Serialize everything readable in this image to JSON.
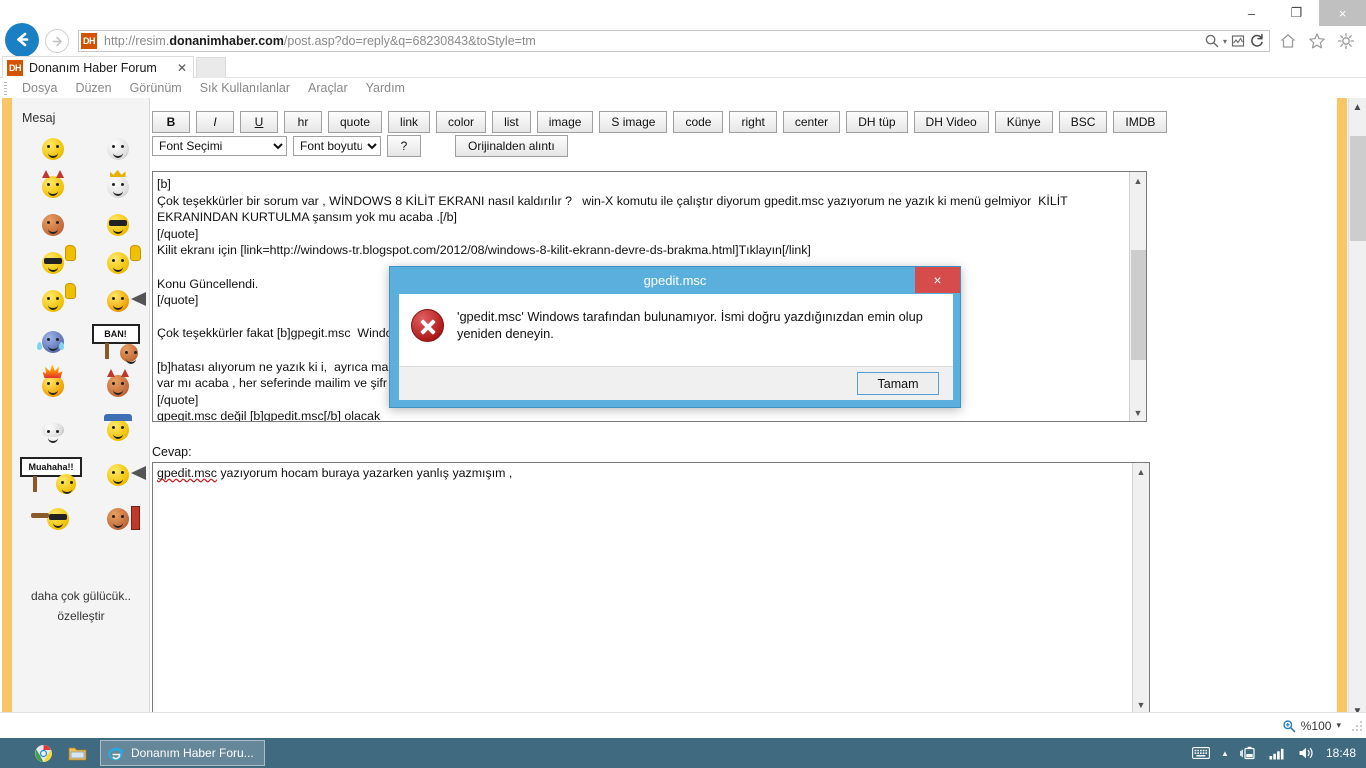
{
  "window": {
    "minimize": "–",
    "maximize": "❐",
    "close": "×"
  },
  "browser": {
    "favicon_text": "DH",
    "url_scheme": "http://",
    "url_domain_prefix": "resim.",
    "url_domain_bold": "donanimhaber.com",
    "url_path": "/post.asp?do=reply&q=68230843&toStyle=tm",
    "back_icon": "back-arrow-icon",
    "forward_icon": "forward-arrow-icon",
    "search_icon": "🔍",
    "dropdown_caret": "▾",
    "compat_icon": "compatibility-view-icon",
    "refresh_icon": "↻",
    "home_icon": "⌂",
    "favorites_icon": "☆",
    "settings_icon": "⚙"
  },
  "tab": {
    "title": "Donanım Haber Forum",
    "close": "✕"
  },
  "menubar": {
    "items": [
      "Dosya",
      "Düzen",
      "Görünüm",
      "Sık Kullanılanlar",
      "Araçlar",
      "Yardım"
    ]
  },
  "sidebar": {
    "title": "Mesaj",
    "footer_line1": "daha çok gülücük..",
    "footer_line2": "özelleştir",
    "sign_ban": "BAN!",
    "sign_muahaha": "Muahaha!!",
    "emoticons": [
      "smiley-yellow",
      "smiley-globe",
      "smiley-devil",
      "smiley-king-globe",
      "smiley-brown",
      "smiley-sunglasses",
      "smiley-cool-thumb",
      "smiley-thumbs-up",
      "smiley-pointing",
      "smiley-megaphone",
      "smiley-crying-blue",
      "smiley-ban-sign",
      "smiley-flame-head",
      "smiley-devil-brown",
      "smiley-ufo",
      "smiley-police-hat",
      "smiley-muahaha-sign",
      "smiley-loudspeaker",
      "smiley-broom-viking",
      "smiley-book"
    ]
  },
  "toolbar": {
    "row1": [
      {
        "label": "B",
        "name": "bold-button"
      },
      {
        "label": "I",
        "name": "italic-button"
      },
      {
        "label": "U",
        "name": "underline-button"
      },
      {
        "label": "hr",
        "name": "hr-button"
      },
      {
        "label": "quote",
        "name": "quote-button"
      },
      {
        "label": "link",
        "name": "link-button"
      },
      {
        "label": "color",
        "name": "color-button"
      },
      {
        "label": "list",
        "name": "list-button"
      },
      {
        "label": "image",
        "name": "image-button"
      },
      {
        "label": "S image",
        "name": "s-image-button"
      },
      {
        "label": "code",
        "name": "code-button"
      },
      {
        "label": "right",
        "name": "right-align-button"
      },
      {
        "label": "center",
        "name": "center-align-button"
      },
      {
        "label": "DH tüp",
        "name": "dh-tup-button"
      },
      {
        "label": "DH Video",
        "name": "dh-video-button"
      },
      {
        "label": "Künye",
        "name": "kunye-button"
      },
      {
        "label": "BSC",
        "name": "bsc-button"
      },
      {
        "label": "IMDB",
        "name": "imdb-button"
      }
    ],
    "font_select": "Font Seçimi",
    "size_select": "Font boyutu",
    "help_label": "?",
    "original_quote_label": "Orijinalden alıntı"
  },
  "quote_editor": {
    "name": "quote-textarea",
    "content": "[b]\nÇok teşekkürler bir sorum var , WİNDOWS 8 KİLİT EKRANI nasıl kaldırılır ?   win-X komutu ile çalıştır diyorum gpedit.msc yazıyorum ne yazık ki menü gelmiyor  KİLİT EKRANINDAN KURTULMA şansım yok mu acaba .[/b]\n[/quote]\nKilit ekranı için [link=http://windows-tr.blogspot.com/2012/08/windows-8-kilit-ekrann-devre-ds-brakma.html]Tıklayın[/link]\n\nKonu Güncellendi.\n[/quote]\n\nÇok teşekkürler fakat [b]gpegit.msc  Windows tarafından bulunamıyor.[/b]\n\n[b]hatası alıyorum ne yazık ki i,  ayrıca ma                                                                                   ifre soruyor başka bir yolu\nvar mı acaba , her seferinde mailim ve şifr\n[/quote]\ngpegit.msc değil [b]gpedit.msc[/b] olacak\n[/quote]"
  },
  "reply": {
    "label": "Cevap:",
    "misspelled_word": "gpedit.msc",
    "rest_text": " yazıyorum hocam buraya yazarken yanlış yazmışım ,"
  },
  "dialog": {
    "title": "gpedit.msc",
    "close": "×",
    "icon": "error-icon",
    "message": "'gpedit.msc' Windows tarafından bulunamıyor. İsmi doğru yazdığınızdan emin olup yeniden deneyin.",
    "ok_label": "Tamam"
  },
  "statusbar": {
    "zoom_icon": "🔍",
    "zoom_level": "%100",
    "caret": "▾"
  },
  "taskbar": {
    "chrome_icon": "chrome-icon",
    "explorer_icon": "file-explorer-icon",
    "task_label": "Donanım Haber Foru...",
    "task_icon": "internet-explorer-icon",
    "tray": {
      "keyboard_icon": "keyboard-icon",
      "show_hidden_icon": "▲",
      "battery_icon": "battery-icon",
      "network_icon": "network-signal-icon",
      "volume_icon": "volume-icon",
      "clock": "18:48"
    }
  },
  "colors": {
    "accent_orange": "#f9c566",
    "dialog_blue": "#5aafdc",
    "error_red": "#b01b1b",
    "taskbar": "#3f6a80",
    "close_red": "#d64c4c"
  }
}
